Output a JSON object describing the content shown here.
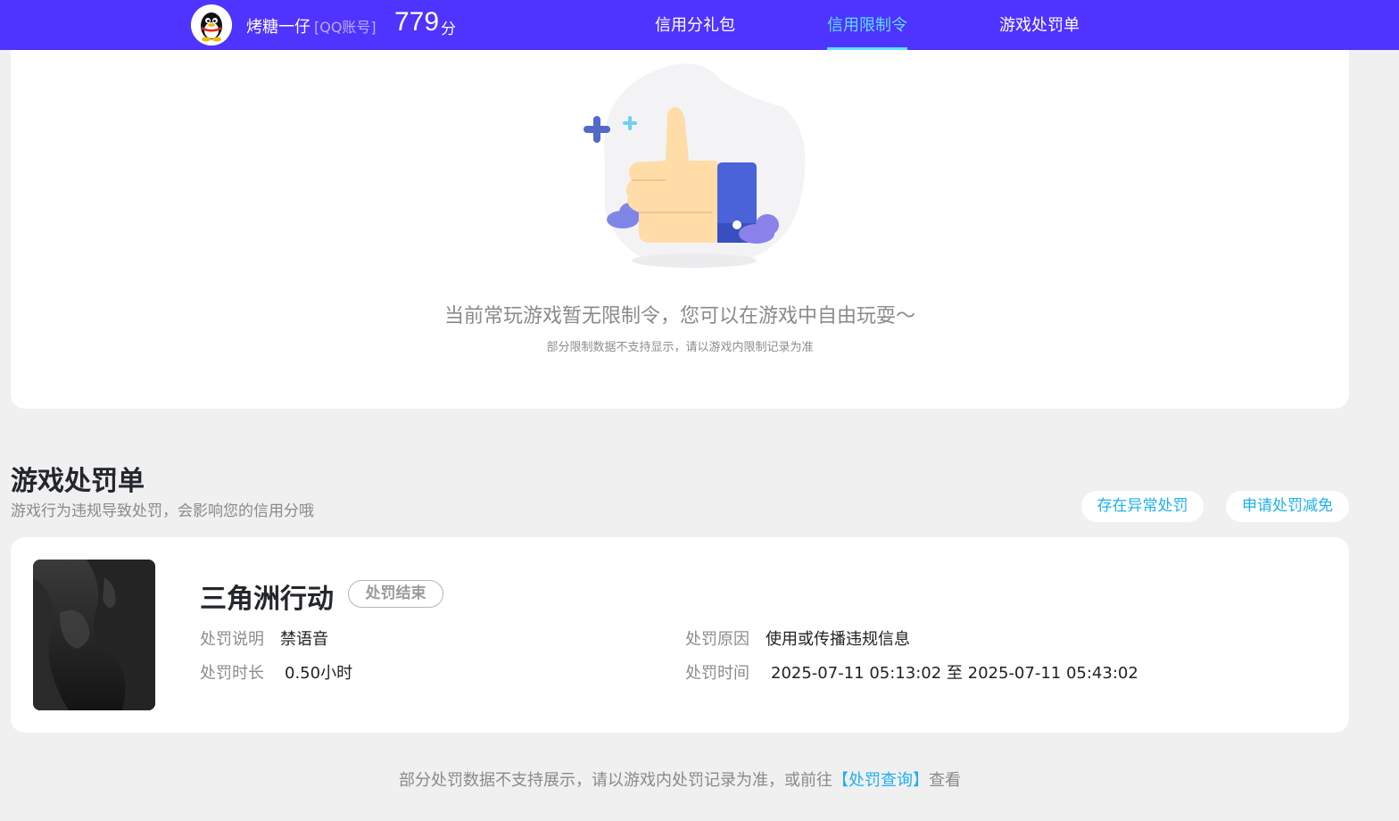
{
  "header": {
    "username": "烤糖一仔",
    "account_type": "[QQ账号]",
    "score": "779",
    "score_unit": "分",
    "tabs": [
      {
        "label": "信用分礼包",
        "active": false
      },
      {
        "label": "信用限制令",
        "active": true
      },
      {
        "label": "游戏处罚单",
        "active": false
      }
    ]
  },
  "restriction": {
    "empty_title": "当前常玩游戏暂无限制令，您可以在游戏中自由玩耍～",
    "empty_subtitle": "部分限制数据不支持显示，请以游戏内限制记录为准"
  },
  "penalty_section": {
    "title": "游戏处罚单",
    "subtitle": "游戏行为违规导致处罚，会影响您的信用分哦",
    "buttons": {
      "abnormal": "存在异常处罚",
      "appeal": "申请处罚减免"
    }
  },
  "penalty_card": {
    "game_name": "三角洲行动",
    "status": "处罚结束",
    "desc_label": "处罚说明",
    "desc_value": "禁语音",
    "reason_label": "处罚原因",
    "reason_value": "使用或传播违规信息",
    "duration_label": "处罚时长",
    "duration_value": "0.50小时",
    "time_label": "处罚时间",
    "time_value": "2025-07-11 05:13:02 至 2025-07-11 05:43:02"
  },
  "footer": {
    "note_before": "部分处罚数据不支持展示，请以游戏内处罚记录为准，或前往",
    "link": "【处罚查询】",
    "note_after": "查看"
  },
  "colors": {
    "header_bg": "#4f33ff",
    "active_tab": "#5ee0ff",
    "link": "#1eb0f0",
    "page_bg": "#f0f0f0"
  }
}
